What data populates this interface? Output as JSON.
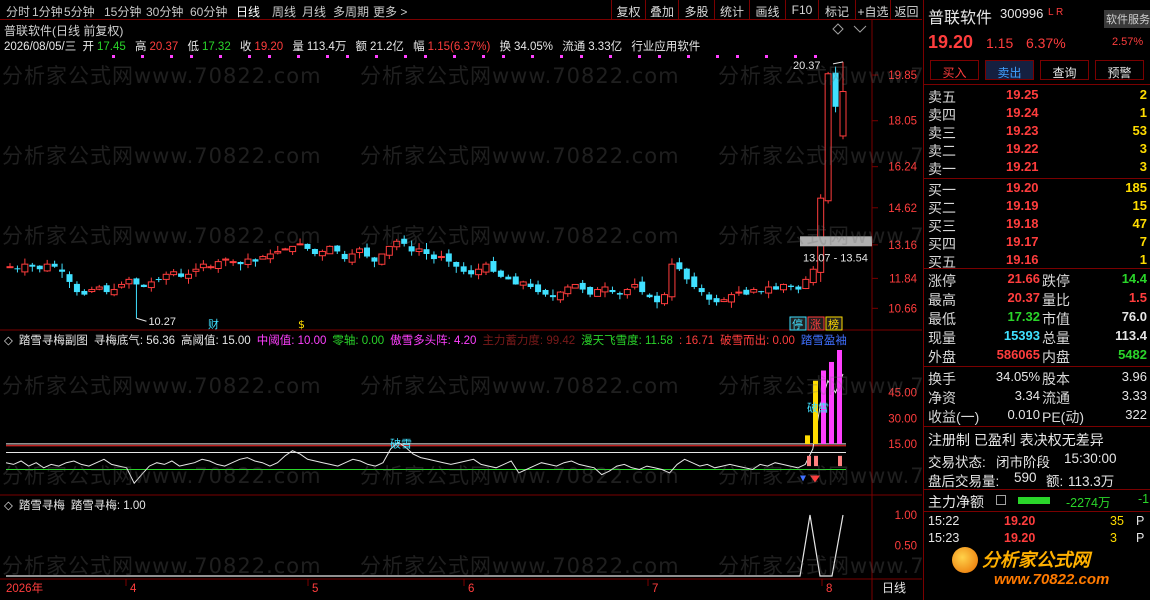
{
  "toolbar": {
    "timeframes": [
      "分时",
      "1分钟",
      "5分钟",
      "15分钟",
      "30分钟",
      "60分钟",
      "日线",
      "周线",
      "月线",
      "多周期",
      "更多 >"
    ],
    "active_timeframe": "日线",
    "buttons": [
      "复权",
      "叠加",
      "多股",
      "统计",
      "画线",
      "F10",
      "标记",
      "+自选",
      "返回"
    ]
  },
  "kline": {
    "title": "普联软件(日线 前复权)",
    "date": "2026/08/05/三",
    "open_label": "开",
    "open": "17.45",
    "high_label": "高",
    "high": "20.37",
    "low_label": "低",
    "low": "17.32",
    "close_label": "收",
    "close": "19.20",
    "vol_label": "量",
    "vol": "113.4万",
    "amt_label": "额",
    "amt": "21.2亿",
    "chg_label": "幅",
    "chg": "1.15(6.37%)",
    "turn_label": "换",
    "turn": "34.05%",
    "float_label": "流通",
    "float": "3.33亿",
    "industry": "行业应用软件",
    "price_ticks": [
      "19.85",
      "18.05",
      "16.24",
      "14.62",
      "13.16",
      "11.84",
      "10.66"
    ],
    "max_label": "20.37",
    "min_label": "10.27",
    "range_label": "13.07 - 13.54",
    "marks": [
      "财",
      "$"
    ],
    "badges": [
      "停",
      "涨",
      "榜"
    ]
  },
  "indicator1": {
    "name": "踏雪寻梅副图",
    "items": [
      {
        "label": "寻梅底气: 56.36",
        "color": "#e6e6e6"
      },
      {
        "label": "高阈值: 15.00",
        "color": "#e6e6e6"
      },
      {
        "label": "中阈值: 10.00",
        "color": "#ff40ff"
      },
      {
        "label": "零轴: 0.00",
        "color": "#2ad52a"
      },
      {
        "label": "傲雪多头阵: 4.20",
        "color": "#ff40ff"
      },
      {
        "label": "主力蓄力度: 99.42",
        "color": "#7a1a1a"
      },
      {
        "label": "漫天飞雪度: 11.58",
        "color": "#2ad52a"
      },
      {
        "label": ": 16.71",
        "color": "#ff3d3d"
      },
      {
        "label": "破雪而出: 0.00",
        "color": "#ff3d3d"
      },
      {
        "label": "踏雪盈袖",
        "color": "#4070ff"
      }
    ],
    "ticks": [
      "45.00",
      "30.00",
      "15.00"
    ],
    "annotation1": "破雪",
    "annotation2": "破雪"
  },
  "indicator2": {
    "name": "踏雪寻梅",
    "value_label": "踏雪寻梅: 1.00",
    "ticks": [
      "1.00",
      "0.50"
    ]
  },
  "xaxis": {
    "labels": [
      "2026年",
      "4",
      "5",
      "6",
      "7",
      "8"
    ],
    "period": "日线"
  },
  "watermark": "分析家公式网www.70822.com",
  "quote": {
    "name": "普联软件",
    "code": "300996",
    "flags": "L R",
    "tag": "软件服务",
    "tag_pct": "2.57%",
    "price": "19.20",
    "change": "1.15",
    "change_pct": "6.37%",
    "buttons": [
      "买入",
      "卖出",
      "查询",
      "预警"
    ],
    "asks": [
      {
        "label": "卖五",
        "price": "19.25",
        "vol": "2"
      },
      {
        "label": "卖四",
        "price": "19.24",
        "vol": "1"
      },
      {
        "label": "卖三",
        "price": "19.23",
        "vol": "53"
      },
      {
        "label": "卖二",
        "price": "19.22",
        "vol": "3"
      },
      {
        "label": "卖一",
        "price": "19.21",
        "vol": "3"
      }
    ],
    "bids": [
      {
        "label": "买一",
        "price": "19.20",
        "vol": "185"
      },
      {
        "label": "买二",
        "price": "19.19",
        "vol": "15"
      },
      {
        "label": "买三",
        "price": "19.18",
        "vol": "47"
      },
      {
        "label": "买四",
        "price": "19.17",
        "vol": "7"
      },
      {
        "label": "买五",
        "price": "19.16",
        "vol": "1"
      }
    ],
    "stats": [
      {
        "l1": "涨停",
        "v1": "21.66",
        "c1": "red",
        "l2": "跌停",
        "v2": "14.4",
        "c2": "green"
      },
      {
        "l1": "最高",
        "v1": "20.37",
        "c1": "red",
        "l2": "量比",
        "v2": "1.5",
        "c2": "red"
      },
      {
        "l1": "最低",
        "v1": "17.32",
        "c1": "green",
        "l2": "市值",
        "v2": "76.0",
        "c2": "white"
      },
      {
        "l1": "现量",
        "v1": "15393",
        "c1": "cyan",
        "l2": "总量",
        "v2": "113.4",
        "c2": "white"
      },
      {
        "l1": "外盘",
        "v1": "586065",
        "c1": "red",
        "l2": "内盘",
        "v2": "5482",
        "c2": "green"
      }
    ],
    "fin": [
      {
        "l1": "换手",
        "v1": "34.05%",
        "l2": "股本",
        "v2": "3.96"
      },
      {
        "l1": "净资",
        "v1": "3.34",
        "l2": "流通",
        "v2": "3.33"
      },
      {
        "l1": "收益(一)",
        "v1": "0.010",
        "l2": "PE(动)",
        "v2": "322"
      }
    ],
    "regime": "注册制 已盈利 表决权无差异",
    "trade_status_label": "交易状态:",
    "trade_status": "闭市阶段",
    "trade_time": "15:30:00",
    "after_label": "盘后交易量:",
    "after_vol": "590",
    "after_amt_label": "额:",
    "after_amt": "113.3万",
    "mainflow_label": "主力净额",
    "mainflow": "-2274万",
    "mainflow_2": "-1",
    "ticks": [
      {
        "time": "15:22",
        "price": "19.20",
        "vol": "35",
        "side": "P"
      },
      {
        "time": "15:23",
        "price": "19.20",
        "vol": "3",
        "side": "P"
      }
    ],
    "brand": "分析家公式网",
    "brand_url": "www.70822.com"
  },
  "colors": {
    "up": "#ff3d3d",
    "down": "#40e0ff",
    "grid": "#7a0000",
    "bg": "#000000"
  },
  "chart_data": [
    {
      "type": "candlestick",
      "title": "普联软件(日线 前复权)",
      "x_range": [
        "2026-03",
        "2026-08"
      ],
      "y_ticks": [
        10.66,
        11.84,
        13.16,
        14.62,
        16.24,
        18.05,
        19.85
      ],
      "ylim": [
        10.2,
        20.6
      ],
      "last_bar": {
        "open": 17.45,
        "high": 20.37,
        "low": 17.32,
        "close": 19.2
      },
      "closes": [
        12.3,
        12.2,
        12.4,
        12.3,
        12.2,
        12.4,
        12.3,
        12.1,
        11.7,
        11.3,
        11.2,
        11.4,
        11.5,
        11.3,
        11.4,
        11.6,
        11.8,
        11.6,
        11.5,
        11.7,
        11.8,
        12.0,
        12.1,
        11.9,
        12.0,
        12.2,
        12.4,
        12.3,
        12.5,
        12.6,
        12.5,
        12.4,
        12.6,
        12.5,
        12.7,
        12.8,
        12.9,
        13.0,
        13.1,
        13.2,
        13.0,
        12.8,
        12.9,
        13.1,
        12.9,
        12.6,
        12.8,
        13.0,
        12.7,
        12.5,
        12.8,
        13.1,
        13.3,
        13.2,
        12.9,
        13.0,
        12.8,
        12.6,
        12.7,
        12.5,
        12.3,
        12.1,
        12.0,
        12.2,
        12.4,
        12.1,
        11.9,
        11.8,
        11.6,
        11.7,
        11.5,
        11.3,
        11.2,
        11.1,
        11.3,
        11.5,
        11.6,
        11.4,
        11.2,
        11.4,
        11.5,
        11.3,
        11.2,
        11.4,
        11.6,
        11.3,
        11.1,
        10.9,
        11.2,
        12.4,
        12.2,
        11.8,
        11.5,
        11.3,
        11.0,
        10.9,
        11.0,
        11.2,
        11.3,
        11.2,
        11.4,
        11.3,
        11.5,
        11.4,
        11.6,
        11.5,
        11.4,
        11.8,
        12.2,
        15.0,
        19.9,
        18.6,
        19.2
      ],
      "max_marker": 20.37,
      "min_marker": 10.27
    },
    {
      "type": "line",
      "title": "踏雪寻梅副图",
      "y_ticks": [
        15.0,
        30.0,
        45.0
      ],
      "series": [
        {
          "name": "寻梅底气",
          "last": 56.36
        },
        {
          "name": "高阈值",
          "last": 15.0
        },
        {
          "name": "中阈值",
          "last": 10.0
        },
        {
          "name": "零轴",
          "last": 0.0
        },
        {
          "name": "傲雪多头阵",
          "last": 4.2
        },
        {
          "name": "主力蓄力度",
          "last": 99.42
        },
        {
          "name": "漫天飞雪度",
          "last": 11.58
        },
        {
          "name": "破雪而出",
          "last": 0.0
        }
      ],
      "bars_tail": [
        20,
        52,
        58,
        63,
        70
      ],
      "line_values": [
        4,
        3,
        5,
        2,
        4,
        1,
        3,
        2,
        4,
        5,
        3,
        2,
        4,
        6,
        3,
        2,
        1,
        -8,
        -3,
        2,
        4,
        3,
        5,
        2,
        3,
        4,
        6,
        5,
        3,
        2,
        4,
        6,
        7,
        5,
        4,
        2,
        4,
        8,
        11,
        9,
        6,
        5,
        4,
        3,
        2,
        4,
        6,
        5,
        3,
        2,
        4,
        12,
        16,
        13,
        9,
        7,
        6,
        5,
        4,
        3,
        4,
        5,
        6,
        3,
        2,
        1,
        3,
        5,
        -2,
        0,
        2,
        4,
        3,
        2,
        4,
        5,
        3,
        2,
        1,
        -3,
        -1,
        2,
        3,
        1,
        0,
        2,
        1,
        0,
        -2,
        3,
        6,
        4,
        2,
        3,
        1,
        2,
        3,
        2,
        1,
        0,
        3,
        2,
        4,
        3,
        2,
        1,
        3,
        12,
        38,
        52,
        45,
        56
      ]
    },
    {
      "type": "line",
      "title": "踏雪寻梅",
      "y_ticks": [
        0.5,
        1.0
      ],
      "series": [
        {
          "name": "踏雪寻梅",
          "last": 1.0
        }
      ],
      "values_tail": [
        0,
        1,
        0,
        0,
        1
      ]
    }
  ]
}
